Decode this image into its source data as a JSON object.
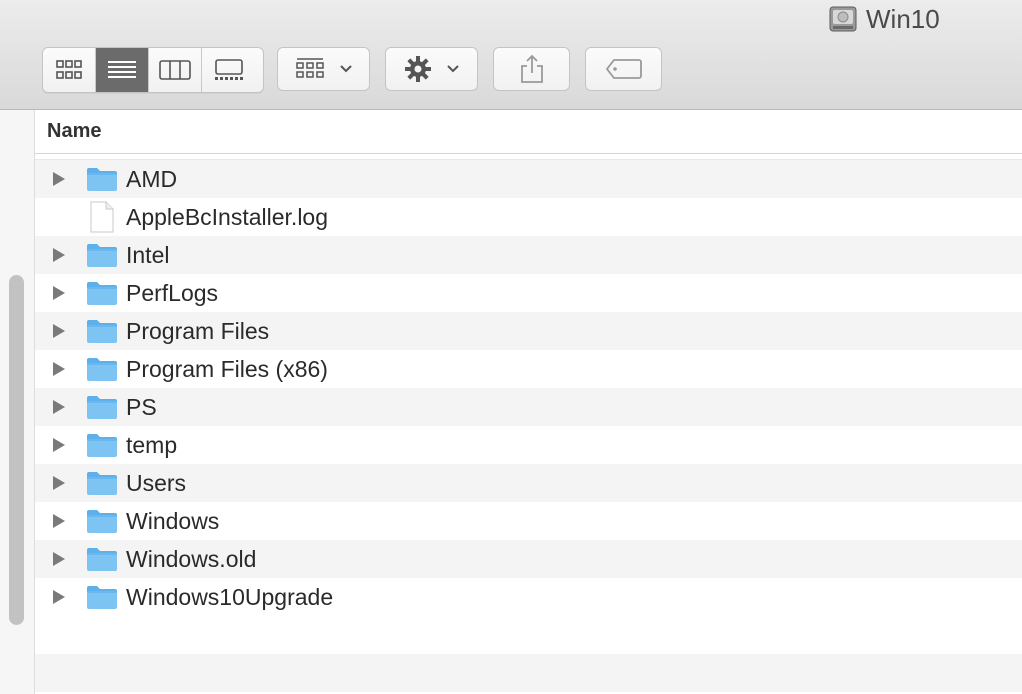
{
  "window": {
    "title": "Win10",
    "title_icon": "hard-disk-icon"
  },
  "toolbar": {
    "view_modes": [
      {
        "name": "icon-view",
        "icon": "grid-icon",
        "active": false
      },
      {
        "name": "list-view",
        "icon": "list-icon",
        "active": true
      },
      {
        "name": "column-view",
        "icon": "columns-icon",
        "active": false
      },
      {
        "name": "gallery-view",
        "icon": "gallery-icon",
        "active": false
      }
    ],
    "arrange_icon": "arrange-grid-icon",
    "action_icon": "gear-icon",
    "share_icon": "share-icon",
    "tag_icon": "tag-icon"
  },
  "list": {
    "column_header": "Name",
    "items": [
      {
        "name": "AMD",
        "type": "folder"
      },
      {
        "name": "AppleBcInstaller.log",
        "type": "file"
      },
      {
        "name": "Intel",
        "type": "folder"
      },
      {
        "name": "PerfLogs",
        "type": "folder"
      },
      {
        "name": "Program Files",
        "type": "folder"
      },
      {
        "name": "Program Files (x86)",
        "type": "folder"
      },
      {
        "name": "PS",
        "type": "folder"
      },
      {
        "name": "temp",
        "type": "folder"
      },
      {
        "name": "Users",
        "type": "folder"
      },
      {
        "name": "Windows",
        "type": "folder"
      },
      {
        "name": "Windows.old",
        "type": "folder"
      },
      {
        "name": "Windows10Upgrade",
        "type": "folder"
      }
    ]
  },
  "colors": {
    "folder": "#7ec4f3",
    "folder_tab": "#5eb0ea",
    "active_segment": "#6b6b6b",
    "row_stripe": "#f4f4f4"
  }
}
